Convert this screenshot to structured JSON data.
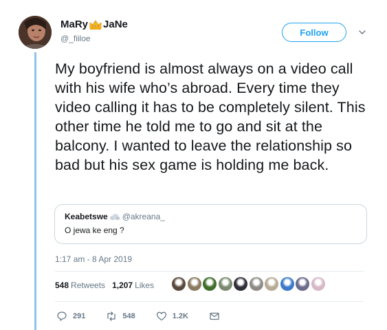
{
  "author": {
    "name_start": "MaRy",
    "name_end": "JaNe",
    "handle": "@_fiiloe"
  },
  "follow_label": "Follow",
  "tweet_text": "My boyfriend is almost always on a video call with his wife who’s abroad. Every time they video calling it has to be completely silent. This other time he told me to go and sit at the balcony. I wanted to leave the relationship so bad but his sex game is holding me back.",
  "quoted": {
    "name": "Keabetswe",
    "handle": "@akreana_",
    "text": "O jewa ke eng ?"
  },
  "timestamp": "1:17 am - 8 Apr 2019",
  "stats": {
    "retweets_count": "548",
    "retweets_label": "Retweets",
    "likes_count": "1,207",
    "likes_label": "Likes"
  },
  "liker_colors": [
    "#5a4a3e",
    "#8c7a60",
    "#3f6e2a",
    "#7a8a70",
    "#2e2e36",
    "#8e8a88",
    "#b8ab95",
    "#3a7ac8",
    "#6a6a8a",
    "#d6b8c8"
  ],
  "actions": {
    "replies": "291",
    "retweets": "548",
    "likes": "1.2K"
  },
  "colors": {
    "accent": "#1da1f2",
    "thread": "#8ec3ee",
    "muted": "#657786"
  }
}
